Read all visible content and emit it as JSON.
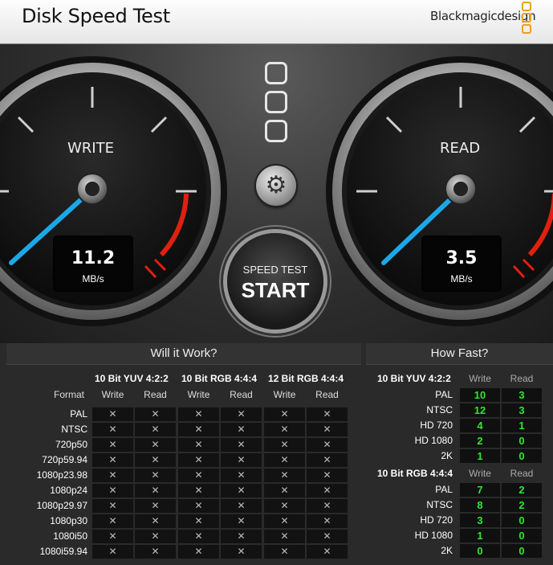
{
  "app_title": "Disk Speed Test",
  "brand": "Blackmagicdesign",
  "write_gauge": {
    "label": "WRITE",
    "value": "11.2",
    "unit": "MB/s"
  },
  "read_gauge": {
    "label": "READ",
    "value": "3.5",
    "unit": "MB/s"
  },
  "start_button": {
    "line1": "SPEED TEST",
    "line2": "START"
  },
  "colors": {
    "needle": "#1aa8e8",
    "redline": "#e02010",
    "green": "#2fe62f",
    "logo_orange": "#e8a020"
  },
  "will_it_work": {
    "title": "Will it Work?",
    "groups": [
      "10 Bit YUV 4:2:2",
      "10 Bit RGB 4:4:4",
      "12 Bit RGB 4:4:4"
    ],
    "format_header": "Format",
    "write_header": "Write",
    "read_header": "Read",
    "mark": "✕",
    "formats": [
      "PAL",
      "NTSC",
      "720p50",
      "720p59.94",
      "1080p23.98",
      "1080p24",
      "1080p29.97",
      "1080p30",
      "1080i50",
      "1080i59.94"
    ]
  },
  "how_fast": {
    "title": "How Fast?",
    "write_header": "Write",
    "read_header": "Read",
    "groups": [
      {
        "name": "10 Bit YUV 4:2:2",
        "rows": [
          {
            "format": "PAL",
            "write": "10",
            "read": "3"
          },
          {
            "format": "NTSC",
            "write": "12",
            "read": "3"
          },
          {
            "format": "HD 720",
            "write": "4",
            "read": "1"
          },
          {
            "format": "HD 1080",
            "write": "2",
            "read": "0"
          },
          {
            "format": "2K",
            "write": "1",
            "read": "0"
          }
        ]
      },
      {
        "name": "10 Bit RGB 4:4:4",
        "rows": [
          {
            "format": "PAL",
            "write": "7",
            "read": "2"
          },
          {
            "format": "NTSC",
            "write": "8",
            "read": "2"
          },
          {
            "format": "HD 720",
            "write": "3",
            "read": "0"
          },
          {
            "format": "HD 1080",
            "write": "1",
            "read": "0"
          },
          {
            "format": "2K",
            "write": "0",
            "read": "0"
          }
        ]
      }
    ]
  }
}
